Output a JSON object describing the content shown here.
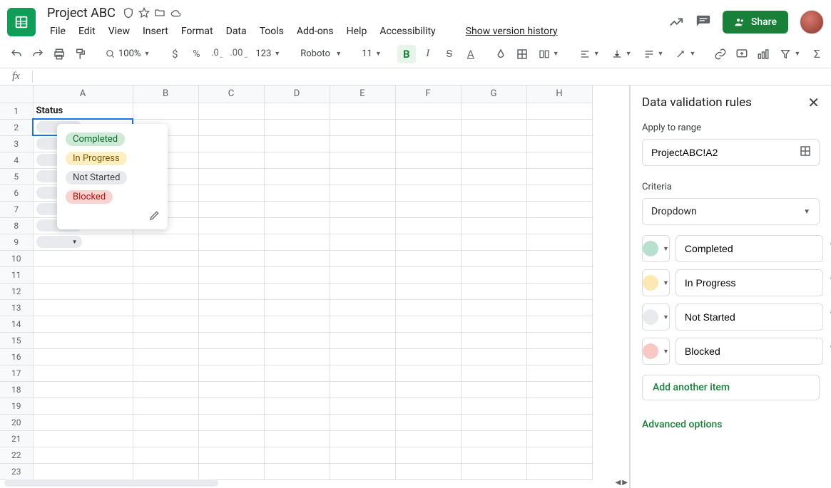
{
  "doc": {
    "title": "Project ABC"
  },
  "menubar": {
    "items": [
      "File",
      "Edit",
      "View",
      "Insert",
      "Format",
      "Data",
      "Tools",
      "Add-ons",
      "Help",
      "Accessibility"
    ],
    "version_history": "Show version history"
  },
  "share_label": "Share",
  "toolbar": {
    "zoom": "100%",
    "number_format": "123",
    "font": "Roboto",
    "font_size": "11"
  },
  "cells": {
    "A1": "Status"
  },
  "columns": [
    "A",
    "B",
    "C",
    "D",
    "E",
    "F",
    "G",
    "H"
  ],
  "rows": 23,
  "dropdown_options": [
    {
      "label": "Completed",
      "color": "green"
    },
    {
      "label": "In Progress",
      "color": "yellow"
    },
    {
      "label": "Not Started",
      "color": "grey"
    },
    {
      "label": "Blocked",
      "color": "red"
    }
  ],
  "panel": {
    "title": "Data validation rules",
    "apply_label": "Apply to range",
    "range": "ProjectABC!A2",
    "criteria_label": "Criteria",
    "criteria_type": "Dropdown",
    "items": [
      {
        "value": "Completed",
        "color": "green"
      },
      {
        "value": "In Progress",
        "color": "yellow"
      },
      {
        "value": "Not Started",
        "color": "grey"
      },
      {
        "value": "Blocked",
        "color": "red"
      }
    ],
    "add_item": "Add another item",
    "advanced": "Advanced options"
  }
}
